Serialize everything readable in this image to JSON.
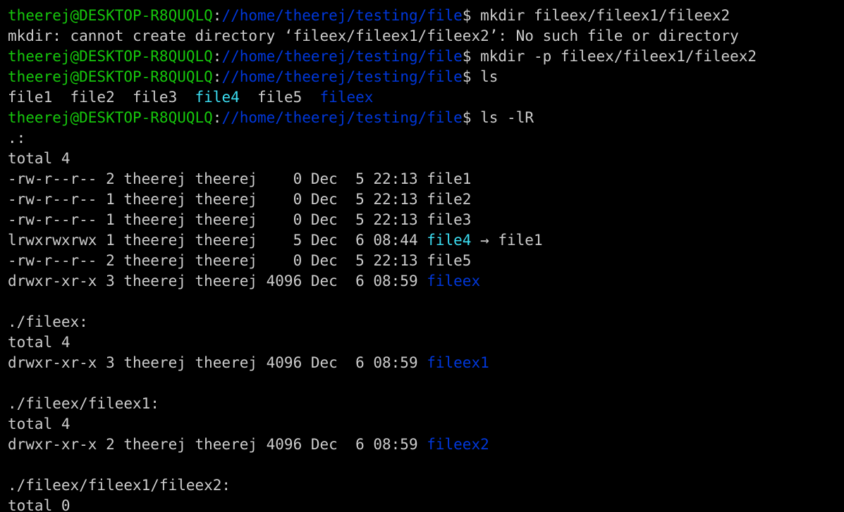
{
  "theme": {
    "background": "#000000",
    "foreground": "#cccccc",
    "prompt_user_color": "#16c60c",
    "prompt_path_color": "#0037da",
    "directory_color": "#0037da",
    "symlink_color": "#3bdcf0"
  },
  "prompt": {
    "user_host": "theerej@DESKTOP-R8QUQLQ",
    "colon": ":",
    "path": "//home/theerej/testing/file",
    "dollar": "$ "
  },
  "lines": [
    {
      "kind": "prompt",
      "command": "mkdir fileex/fileex1/fileex2"
    },
    {
      "kind": "output",
      "segments": [
        {
          "text": "mkdir: cannot create directory ‘fileex/fileex1/fileex2’: No such file or directory",
          "color": "default"
        }
      ]
    },
    {
      "kind": "prompt",
      "command": "mkdir -p fileex/fileex1/fileex2"
    },
    {
      "kind": "prompt",
      "command": "ls"
    },
    {
      "kind": "output",
      "segments": [
        {
          "text": "file1  file2  file3  ",
          "color": "default"
        },
        {
          "text": "file4",
          "color": "cyan"
        },
        {
          "text": "  file5  ",
          "color": "default"
        },
        {
          "text": "fileex",
          "color": "blue"
        }
      ]
    },
    {
      "kind": "prompt",
      "command": "ls -lR"
    },
    {
      "kind": "output",
      "segments": [
        {
          "text": ".:",
          "color": "default"
        }
      ]
    },
    {
      "kind": "output",
      "segments": [
        {
          "text": "total 4",
          "color": "default"
        }
      ]
    },
    {
      "kind": "output",
      "segments": [
        {
          "text": "-rw-r--r-- 2 theerej theerej    0 Dec  5 22:13 file1",
          "color": "default"
        }
      ]
    },
    {
      "kind": "output",
      "segments": [
        {
          "text": "-rw-r--r-- 1 theerej theerej    0 Dec  5 22:13 file2",
          "color": "default"
        }
      ]
    },
    {
      "kind": "output",
      "segments": [
        {
          "text": "-rw-r--r-- 1 theerej theerej    0 Dec  5 22:13 file3",
          "color": "default"
        }
      ]
    },
    {
      "kind": "output",
      "segments": [
        {
          "text": "lrwxrwxrwx 1 theerej theerej    5 Dec  6 08:44 ",
          "color": "default"
        },
        {
          "text": "file4",
          "color": "cyan"
        },
        {
          "text": " → file1",
          "color": "default"
        }
      ]
    },
    {
      "kind": "output",
      "segments": [
        {
          "text": "-rw-r--r-- 2 theerej theerej    0 Dec  5 22:13 file5",
          "color": "default"
        }
      ]
    },
    {
      "kind": "output",
      "segments": [
        {
          "text": "drwxr-xr-x 3 theerej theerej 4096 Dec  6 08:59 ",
          "color": "default"
        },
        {
          "text": "fileex",
          "color": "blue"
        }
      ]
    },
    {
      "kind": "output",
      "segments": []
    },
    {
      "kind": "output",
      "segments": [
        {
          "text": "./fileex:",
          "color": "default"
        }
      ]
    },
    {
      "kind": "output",
      "segments": [
        {
          "text": "total 4",
          "color": "default"
        }
      ]
    },
    {
      "kind": "output",
      "segments": [
        {
          "text": "drwxr-xr-x 3 theerej theerej 4096 Dec  6 08:59 ",
          "color": "default"
        },
        {
          "text": "fileex1",
          "color": "blue"
        }
      ]
    },
    {
      "kind": "output",
      "segments": []
    },
    {
      "kind": "output",
      "segments": [
        {
          "text": "./fileex/fileex1:",
          "color": "default"
        }
      ]
    },
    {
      "kind": "output",
      "segments": [
        {
          "text": "total 4",
          "color": "default"
        }
      ]
    },
    {
      "kind": "output",
      "segments": [
        {
          "text": "drwxr-xr-x 2 theerej theerej 4096 Dec  6 08:59 ",
          "color": "default"
        },
        {
          "text": "fileex2",
          "color": "blue"
        }
      ]
    },
    {
      "kind": "output",
      "segments": []
    },
    {
      "kind": "output",
      "segments": [
        {
          "text": "./fileex/fileex1/fileex2:",
          "color": "default"
        }
      ]
    },
    {
      "kind": "output",
      "segments": [
        {
          "text": "total 0",
          "color": "default"
        }
      ]
    }
  ]
}
